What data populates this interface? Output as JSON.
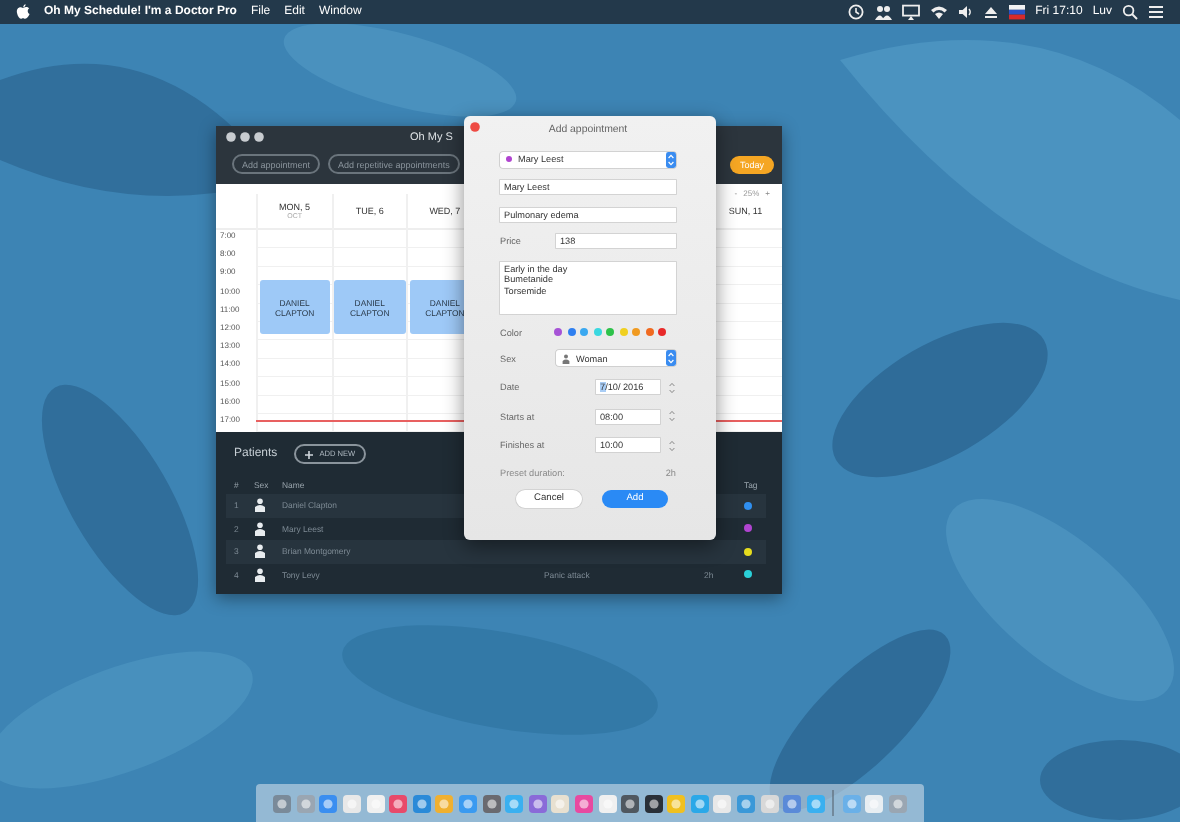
{
  "menu_bar": {
    "app_name": "Oh My Schedule! I'm a Doctor Pro",
    "menus": [
      "File",
      "Edit",
      "Window"
    ],
    "clock": "Fri 17:10",
    "user": "Luv"
  },
  "app_window": {
    "title": "Oh My S",
    "toolbar_buttons": [
      "Add appointment",
      "Add repetitive appointments"
    ],
    "today_button": "Today",
    "zoom": {
      "minus": "-",
      "value": "25%",
      "plus": "+"
    },
    "calendar": {
      "hours": [
        "7:00",
        "8:00",
        "9:00",
        "10:00",
        "11:00",
        "12:00",
        "13:00",
        "14:00",
        "15:00",
        "16:00",
        "17:00"
      ],
      "days": [
        {
          "label": "MON, 5",
          "sub": "OCT",
          "events": [
            {
              "title": "DANIEL CLAPTON"
            }
          ]
        },
        {
          "label": "TUE, 6",
          "events": [
            {
              "title": "DANIEL CLAPTON"
            }
          ]
        },
        {
          "label": "WED, 7",
          "events": [
            {
              "title": "DANIEL CLAPTON"
            }
          ]
        },
        {
          "label": "SUN, 11"
        }
      ]
    },
    "patients": {
      "title": "Patients",
      "add_button": "ADD NEW",
      "columns": [
        "#",
        "Sex",
        "Name",
        "Tag"
      ],
      "rows": [
        {
          "number": "1",
          "name": "Daniel Clapton",
          "color": "#2f8ff0"
        },
        {
          "number": "2",
          "name": "Mary Leest",
          "color": "#b044d0"
        },
        {
          "number": "3",
          "name": "Brian Montgomery",
          "color": "#e6dc1e"
        },
        {
          "number": "4",
          "name": "Tony Levy",
          "diagnosis": "Panic attack",
          "duration": "2h",
          "color": "#2ad0d8"
        }
      ]
    }
  },
  "dialog": {
    "title": "Add appointment",
    "patient": {
      "value": "Mary Leest",
      "color": "#b044d0"
    },
    "fields": [
      {
        "kind": "text",
        "value": "Mary Leest"
      },
      {
        "kind": "text",
        "value": "Pulmonary edema"
      },
      {
        "kind": "labeled",
        "label": "Price",
        "value": "138"
      },
      {
        "kind": "textarea",
        "lines": [
          "Early in the day",
          "Bumetanide",
          "Torsemide"
        ]
      }
    ],
    "color_label": "Color",
    "colors": [
      {
        "color": "#a653d6"
      },
      {
        "color": "#2f7ff0"
      },
      {
        "color": "#3aa8f0"
      },
      {
        "color": "#3ad8e0"
      },
      {
        "color": "#2ec24a"
      },
      {
        "color": "#f0d020"
      },
      {
        "color": "#f09a20"
      },
      {
        "color": "#f06a20"
      },
      {
        "color": "#e82a2a"
      }
    ],
    "sex": {
      "label": "Sex",
      "value": "Woman"
    },
    "date": {
      "label": "Date",
      "segments": [
        {
          "text": "7",
          "selected": true
        },
        {
          "text": "/10/ 2016",
          "selected": false
        }
      ]
    },
    "times": [
      {
        "label": "Starts at",
        "value": "08:00"
      },
      {
        "label": "Finishes at",
        "value": "10:00"
      }
    ],
    "preset": {
      "label": "Preset duration:",
      "value": "2h"
    },
    "buttons": [
      {
        "kind": "cancel",
        "label": "Cancel"
      },
      {
        "kind": "default",
        "label": "Add"
      }
    ]
  }
}
